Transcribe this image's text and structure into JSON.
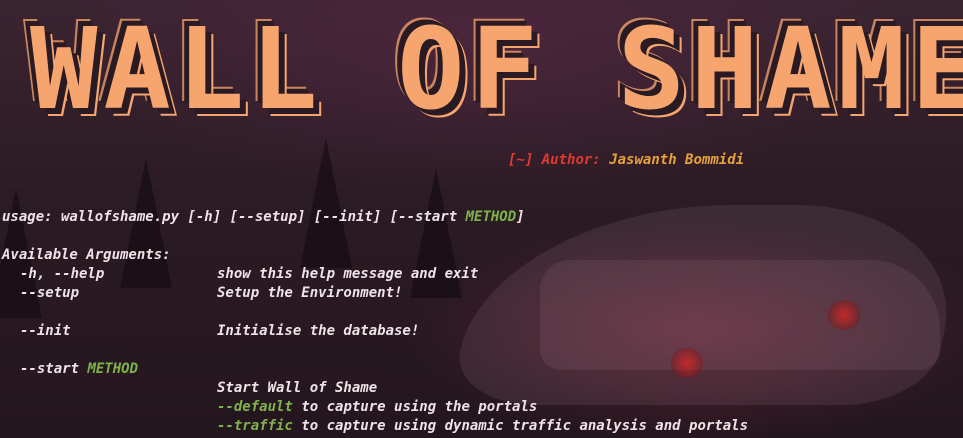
{
  "banner": {
    "title": "WALL OF SHAME"
  },
  "author": {
    "prefix": "[~]",
    "label": "Author:",
    "name": "Jaswanth Bommidi"
  },
  "usage": {
    "prefix": "usage: wallofshame.py [-h] [--setup] [--init] [--start ",
    "method": "METHOD",
    "suffix": "]"
  },
  "arguments": {
    "heading": "Available Arguments:",
    "help": {
      "flag": "-h, --help",
      "desc": "show this help message and exit"
    },
    "setup": {
      "flag": "--setup",
      "desc": "Setup the Environment!"
    },
    "init": {
      "flag": "--init",
      "desc": "Initialise the database!"
    },
    "start": {
      "flag": "--start",
      "method": "METHOD",
      "desc": "Start Wall of Shame",
      "options": [
        {
          "name": "--default",
          "desc": "to capture using the portals"
        },
        {
          "name": "--traffic",
          "desc": "to capture using dynamic traffic analysis and portals"
        }
      ]
    }
  },
  "colors": {
    "banner": "#f7a56e",
    "accent_red": "#e03a2f",
    "accent_gold": "#e8a23a",
    "accent_green": "#7fb24a"
  }
}
